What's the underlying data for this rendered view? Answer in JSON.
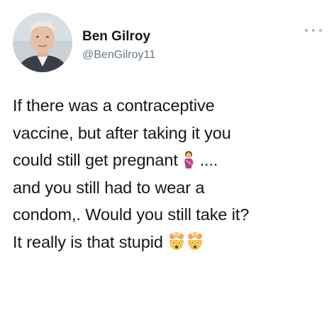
{
  "author": {
    "display_name": "Ben Gilroy",
    "handle": "@BenGilroy11"
  },
  "tweet": {
    "line1": "If there was a contraceptive",
    "line2": "vaccine, but after taking it you",
    "line3_before": "could still get pregnant",
    "line3_after": " ....",
    "line4": "and you still had to wear a",
    "line5": "condom,. Would you still take it?",
    "line6": "It really is that stupid",
    "emojis": [
      "pregnant-woman-icon",
      "exploding-head-icon",
      "exploding-head-icon"
    ]
  },
  "colors": {
    "text": "#14171a",
    "secondary": "#657786",
    "background": "#ffffff"
  }
}
